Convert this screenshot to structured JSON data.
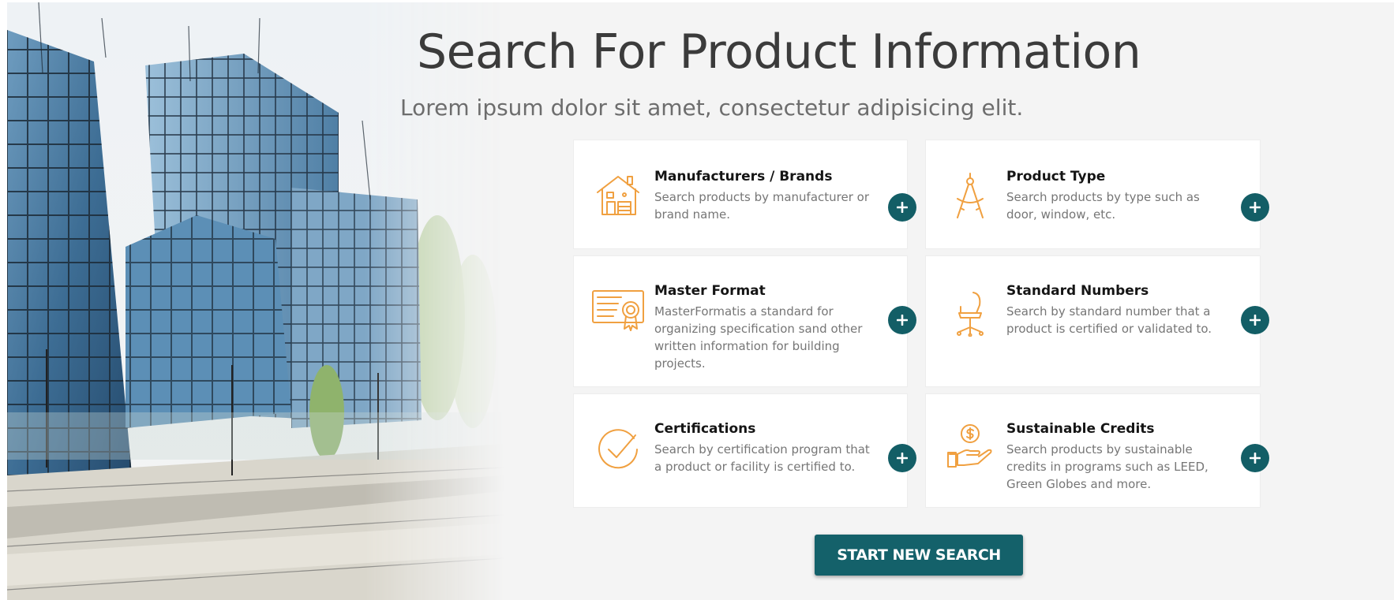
{
  "header": {
    "title": "Search For Product Information",
    "subtitle": "Lorem ipsum dolor sit amet, consectetur adipisicing elit."
  },
  "cards": [
    {
      "title": "Manufacturers / Brands",
      "description": "Search products by manufacturer or brand name.",
      "icon": "house-icon"
    },
    {
      "title": "Product Type",
      "description": "Search products by type such as door, window, etc.",
      "icon": "drafting-compass-icon"
    },
    {
      "title": "Master Format",
      "description": "MasterFormatis a standard for organizing specification sand other written information for building projects.",
      "icon": "certificate-icon"
    },
    {
      "title": "Standard Numbers",
      "description": "Search by standard number that a product is certified or validated to.",
      "icon": "office-chair-icon"
    },
    {
      "title": "Certifications",
      "description": "Search by certification program that a product or facility is certified to.",
      "icon": "check-circle-icon"
    },
    {
      "title": "Sustainable Credits",
      "description": "Search products by sustainable credits in programs such as LEED, Green Globes and more.",
      "icon": "hand-coin-icon"
    }
  ],
  "cta": {
    "label": "START NEW SEARCH"
  },
  "colors": {
    "accent": "#135e66",
    "icon": "#f0a040",
    "background": "#f4f4f4",
    "card": "#ffffff"
  }
}
